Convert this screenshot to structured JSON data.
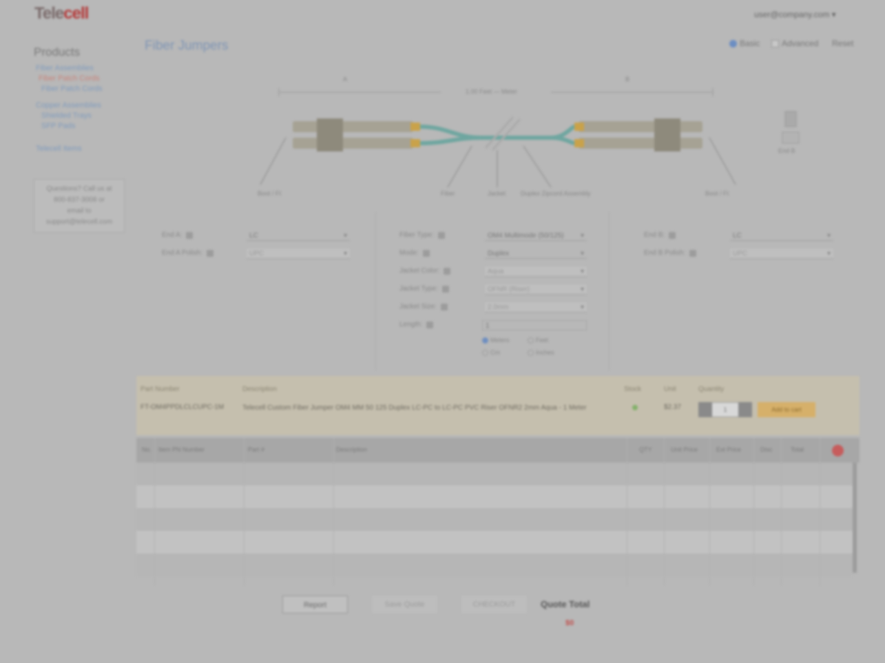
{
  "header": {
    "logo_part1": "Tele",
    "logo_part2": "cell",
    "user_menu": "user@company.com ▾"
  },
  "sidebar": {
    "title": "Products",
    "items": [
      {
        "label": "Fiber Assemblies",
        "active": false
      },
      {
        "label": "Fiber Patch Cords",
        "active": true
      },
      {
        "label": "Fiber Patch Cords",
        "active": false
      },
      {
        "label": "Copper Assemblies",
        "active": false
      },
      {
        "label": "Shielded Trays",
        "active": false
      },
      {
        "label": "SFP Pads",
        "active": false
      },
      {
        "label": "Telecell Items",
        "active": false
      }
    ],
    "support_lines": [
      "Questions? Call us at",
      "800-837-3008 or",
      "email to",
      "support@telecell.com"
    ]
  },
  "page": {
    "title": "Fiber Jumpers",
    "modes": [
      {
        "label": "Basic",
        "checked": true
      },
      {
        "label": "Advanced",
        "checked": false
      },
      {
        "label": "Reset",
        "checked": false
      }
    ]
  },
  "diagram": {
    "end_a": "A",
    "end_b": "B",
    "length_label": "1.00 Feet  —  Meter",
    "callouts": [
      "Boot / Ft",
      "Fiber",
      "Jacket",
      "Duplex Zipcord Assembly",
      "Boot / Ft"
    ],
    "side_note": "End B"
  },
  "config": {
    "left": [
      {
        "label": "End A:",
        "value": "LC"
      },
      {
        "label": "End A Polish:",
        "value": "UPC"
      }
    ],
    "middle": [
      {
        "label": "Fiber Type:",
        "value": "OM4 Multimode (50/125)"
      },
      {
        "label": "Mode:",
        "value": "Duplex"
      },
      {
        "label": "Jacket Color:",
        "value": "Aqua"
      },
      {
        "label": "Jacket Type:",
        "value": "OFNR (Riser)"
      },
      {
        "label": "Jacket Size:",
        "value": "2.0mm"
      },
      {
        "label": "Length:",
        "value": "1"
      }
    ],
    "right": [
      {
        "label": "End B:",
        "value": "LC"
      },
      {
        "label": "End B Polish:",
        "value": "UPC"
      }
    ],
    "units": [
      {
        "label": "Meters",
        "on": true
      },
      {
        "label": "Feet",
        "on": false
      },
      {
        "label": "Cm",
        "on": false
      },
      {
        "label": "Inches",
        "on": false
      }
    ]
  },
  "result": {
    "headers": {
      "part": "Part Number",
      "desc": "Description",
      "stock": "Stock",
      "price": "Unit",
      "qty": "Quantity"
    },
    "part_number": "FT-OM4PPDLCLCUPC-1M",
    "description": "Telecell Custom Fiber Jumper OM4 MM 50 125 Duplex LC-PC to LC-PC PVC Riser OFNR2 2mm Aqua - 1 Meter",
    "price": "$2.37",
    "qty_value": "1",
    "add_label": "Add to cart"
  },
  "table": {
    "headers": [
      "No.",
      "Item PN Number",
      "Part #",
      "Description",
      "QTY",
      "Unit Price",
      "Ext Price",
      "Disc",
      "Total"
    ]
  },
  "footer": {
    "report": "Report",
    "save": "Save Quote",
    "checkout": "CHECKOUT",
    "quote_total_label": "Quote Total",
    "quote_total_value": "$0"
  }
}
